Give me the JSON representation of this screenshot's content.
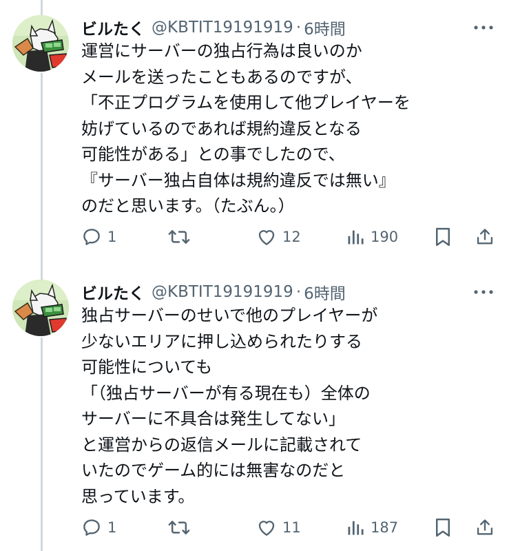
{
  "tweets": [
    {
      "author": {
        "display_name": "ビルたく",
        "handle": "@KBTIT19191919",
        "separator": "·",
        "time": "6時間"
      },
      "body_lines": [
        "運営にサーバーの独占行為は良いのか",
        "メールを送ったこともあるのですが、",
        "「不正プログラムを使用して他プレイヤーを",
        "妨げているのであれば規約違反となる",
        "可能性がある」との事でしたので、",
        "『サーバー独占自体は規約違反では無い』",
        "のだと思います。（たぶん。）"
      ],
      "stats": {
        "replies": "1",
        "reposts": "",
        "likes": "12",
        "views": "190"
      }
    },
    {
      "author": {
        "display_name": "ビルたく",
        "handle": "@KBTIT19191919",
        "separator": "·",
        "time": "6時間"
      },
      "body_lines": [
        "独占サーバーのせいで他のプレイヤーが",
        "少ないエリアに押し込められたりする",
        "可能性についても",
        "「（独占サーバーが有る現在も）全体の",
        "サーバーに不具合は発生してない」",
        "と運営からの返信メールに記載されて",
        "いたのでゲーム的には無害なのだと",
        "思っています。"
      ],
      "stats": {
        "replies": "1",
        "reposts": "",
        "likes": "11",
        "views": "187"
      }
    }
  ],
  "icons": {
    "more": "more-horizontal-icon",
    "reply": "reply-bubble-icon",
    "repost": "repost-arrows-icon",
    "like": "heart-icon",
    "views": "bar-chart-icon",
    "bookmark": "bookmark-icon",
    "share": "share-upload-icon"
  },
  "colors": {
    "text_primary": "#0f1419",
    "text_secondary": "#536471",
    "thread_line": "#cfd9de",
    "background": "#ffffff"
  }
}
